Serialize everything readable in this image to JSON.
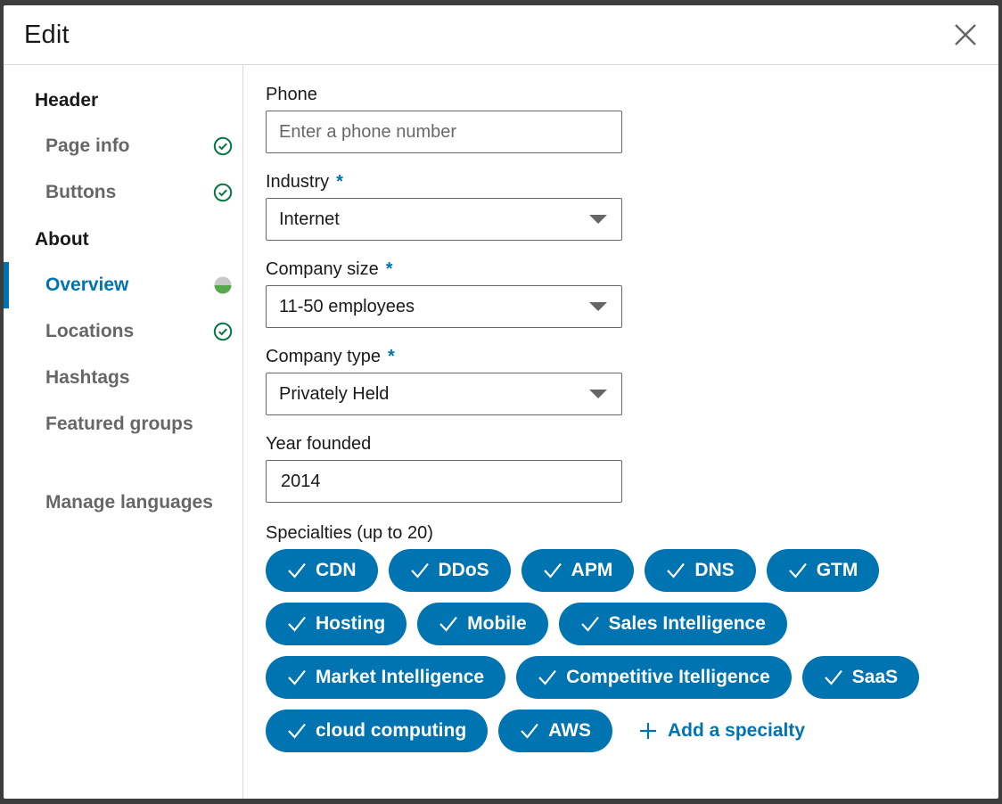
{
  "modal": {
    "title": "Edit"
  },
  "sidebar": {
    "header_heading": "Header",
    "about_heading": "About",
    "items": [
      {
        "label": "Page info",
        "status": "complete"
      },
      {
        "label": "Buttons",
        "status": "complete"
      },
      {
        "label": "Overview",
        "status": "partial",
        "active": true
      },
      {
        "label": "Locations",
        "status": "complete"
      },
      {
        "label": "Hashtags",
        "status": "none"
      },
      {
        "label": "Featured groups",
        "status": "none"
      },
      {
        "label": "Manage languages",
        "status": "none"
      }
    ]
  },
  "form": {
    "phone": {
      "label": "Phone",
      "value": "",
      "placeholder": "Enter a phone number"
    },
    "industry": {
      "label": "Industry",
      "required": "*",
      "value": "Internet"
    },
    "company_size": {
      "label": "Company size",
      "required": "*",
      "value": "11-50 employees"
    },
    "company_type": {
      "label": "Company type",
      "required": "*",
      "value": "Privately Held"
    },
    "year_founded": {
      "label": "Year founded",
      "value": "2014"
    },
    "specialties": {
      "label": "Specialties (up to 20)",
      "items": [
        "CDN",
        "DDoS",
        "APM",
        "DNS",
        "GTM",
        "Hosting",
        "Mobile",
        "Sales Intelligence",
        "Market Intelligence",
        "Competitive Itelligence",
        "SaaS",
        "cloud computing",
        "AWS"
      ],
      "add_label": "Add a specialty"
    }
  },
  "colors": {
    "accent": "#0073b1",
    "complete": "#057642",
    "partial": "#057642"
  },
  "icons": {
    "close": "close-icon",
    "complete": "check-circle-icon",
    "partial": "half-circle-icon",
    "chip_check": "checkmark-icon",
    "add": "plus-icon",
    "dropdown": "caret-down-icon"
  }
}
